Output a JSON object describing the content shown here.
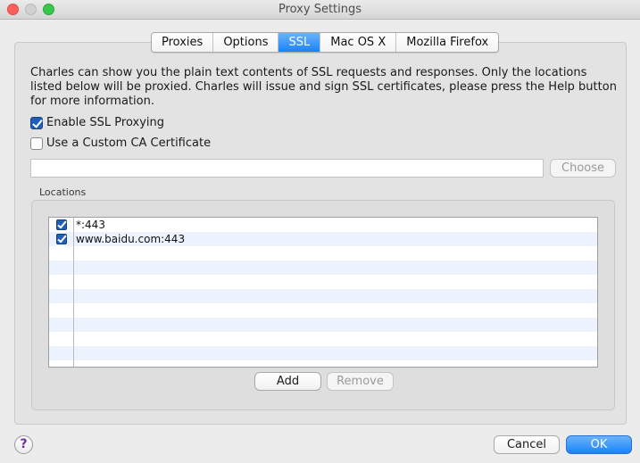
{
  "window": {
    "title": "Proxy Settings"
  },
  "tabs": [
    {
      "label": "Proxies",
      "active": false
    },
    {
      "label": "Options",
      "active": false
    },
    {
      "label": "SSL",
      "active": true
    },
    {
      "label": "Mac OS X",
      "active": false
    },
    {
      "label": "Mozilla Firefox",
      "active": false
    }
  ],
  "ssl": {
    "description": "Charles can show you the plain text contents of SSL requests and responses. Only the locations listed below will be proxied. Charles will issue and sign SSL certificates, please press the Help button for more information.",
    "enable_ssl_label": "Enable SSL Proxying",
    "enable_ssl_checked": true,
    "custom_ca_label": "Use a Custom CA Certificate",
    "custom_ca_checked": false,
    "ca_path_value": "",
    "choose_label": "Choose",
    "locations_label": "Locations",
    "locations": [
      {
        "enabled": true,
        "location": "*:443"
      },
      {
        "enabled": true,
        "location": "www.baidu.com:443"
      }
    ],
    "add_label": "Add",
    "remove_label": "Remove"
  },
  "footer": {
    "help_label": "?",
    "cancel_label": "Cancel",
    "ok_label": "OK"
  },
  "colors": {
    "accent": "#1a82fb",
    "row_alt": "#edf3fe"
  }
}
